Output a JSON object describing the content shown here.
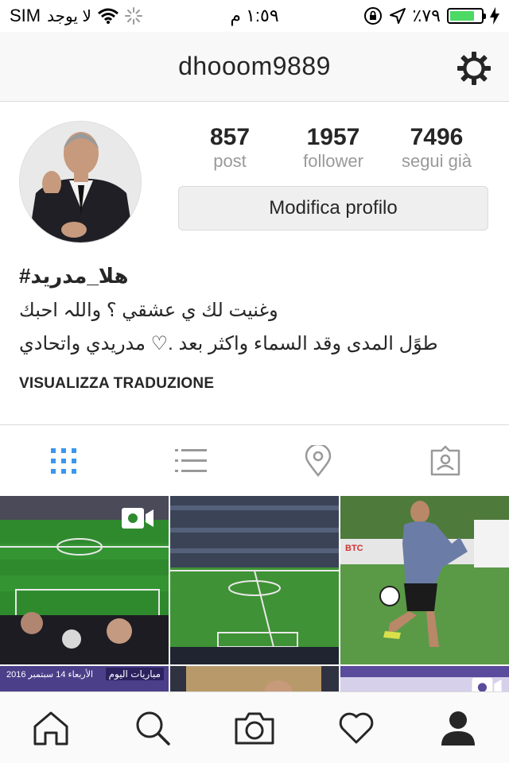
{
  "status_bar": {
    "carrier": "SIM",
    "no_service": "لا يوجد",
    "time": "١:٥٩ م",
    "battery_percent": "٪٧٩",
    "battery_level": 0.79
  },
  "header": {
    "username": "dhooom9889"
  },
  "stats": [
    {
      "value": "857",
      "label": "post"
    },
    {
      "value": "1957",
      "label": "follower"
    },
    {
      "value": "7496",
      "label": "segui già"
    }
  ],
  "edit_profile_label": "Modifica profilo",
  "bio": {
    "name": "#هلا_مدريد",
    "line1": "وغنيت لك ي عشقي ؟ واللہ احبك",
    "line2": "طوًل المدى وقد السماء واكثر بعد .♡ مدريدي واتحادي"
  },
  "translate_label": "VISUALIZZA TRADUZIONE",
  "grid_overlays": {
    "tile4_text_a": "مباريات اليوم",
    "tile4_text_b": "الأربعاء 14 سبتمبر 2016",
    "tile3_sign": "BTC"
  }
}
